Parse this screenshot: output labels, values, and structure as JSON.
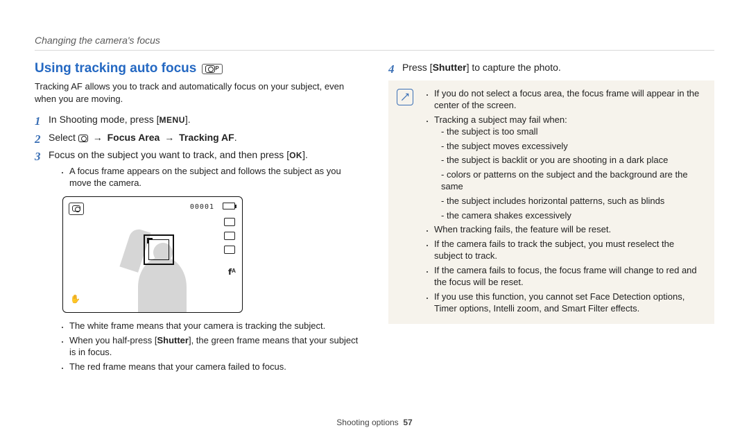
{
  "breadcrumb": "Changing the camera's focus",
  "heading": "Using tracking auto focus",
  "heading_icon_label": "P",
  "intro": "Tracking AF allows you to track and automatically focus on your subject, even when you are moving.",
  "steps": {
    "s1_a": "In Shooting mode, press [",
    "s1_btn": "MENU",
    "s1_b": "].",
    "s2_a": "Select ",
    "s2_arrow1": " → ",
    "s2_fa": "Focus Area",
    "s2_arrow2": " → ",
    "s2_taf": "Tracking AF",
    "s2_end": ".",
    "s3_a": "Focus on the subject you want to track, and then press [",
    "s3_btn": "OK",
    "s3_b": "].",
    "s3_sub": "A focus frame appears on the subject and follows the subject as you move the camera.",
    "s4_a": "Press [",
    "s4_bold": "Shutter",
    "s4_b": "] to capture the photo."
  },
  "lcd": {
    "counter": "00001",
    "flash": "𝗳ᴬ",
    "shake": "✋"
  },
  "left_bullets": {
    "b1": "The white frame means that your camera is tracking the subject.",
    "b2a": "When you half-press [",
    "b2bold": "Shutter",
    "b2b": "], the green frame means that your subject is in focus.",
    "b3": "The red frame means that your camera failed to focus."
  },
  "note": {
    "n1": "If you do not select a focus area, the focus frame will appear in the center of the screen.",
    "n2": "Tracking a subject may fail when:",
    "n2_sub": [
      "the subject is too small",
      "the subject moves excessively",
      "the subject is backlit or you are shooting in a dark place",
      "colors or patterns on the subject and the background are the same",
      "the subject includes horizontal patterns, such as blinds",
      "the camera shakes excessively"
    ],
    "n3": "When tracking fails, the feature will be reset.",
    "n4": "If the camera fails to track the subject, you must reselect the subject to track.",
    "n5": "If the camera fails to focus, the focus frame will change to red and the focus will be reset.",
    "n6": "If you use this function, you cannot set Face Detection options, Timer options, Intelli zoom, and Smart Filter effects."
  },
  "footer_section": "Shooting options",
  "footer_page": "57"
}
